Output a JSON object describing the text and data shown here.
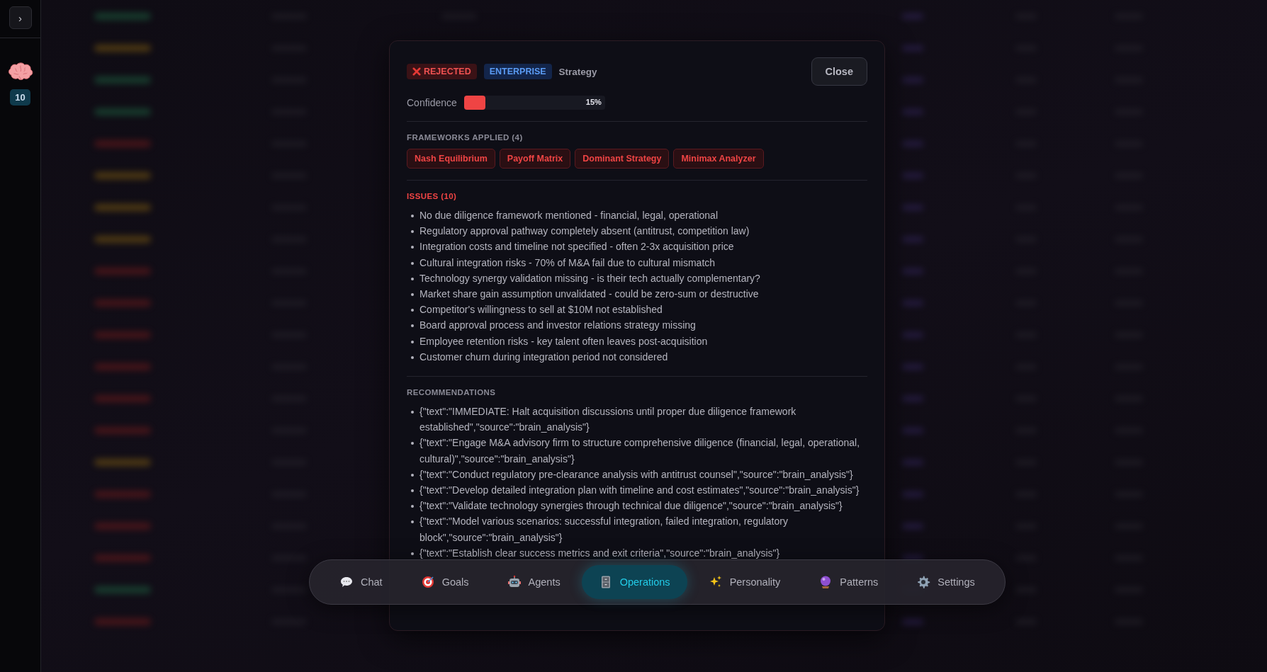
{
  "sidebar": {
    "toggle": "›",
    "count": "10"
  },
  "modal": {
    "status": {
      "label": "REJECTED",
      "kind": "rejected"
    },
    "tier": "ENTERPRISE",
    "category": "Strategy",
    "close": "Close",
    "confidence": {
      "label": "Confidence",
      "level": 0.15,
      "reading": "15%"
    },
    "frameworks": {
      "heading": "FRAMEWORKS APPLIED (4)",
      "items": [
        "Nash Equilibrium",
        "Payoff Matrix",
        "Dominant Strategy",
        "Minimax Analyzer"
      ]
    },
    "issues": {
      "heading": "ISSUES (10)",
      "items": [
        "No due diligence framework mentioned - financial, legal, operational",
        "Regulatory approval pathway completely absent (antitrust, competition law)",
        "Integration costs and timeline not specified - often 2-3x acquisition price",
        "Cultural integration risks - 70% of M&A fail due to cultural mismatch",
        "Technology synergy validation missing - is their tech actually complementary?",
        "Market share gain assumption unvalidated - could be zero-sum or destructive",
        "Competitor's willingness to sell at $10M not established",
        "Board approval process and investor relations strategy missing",
        "Employee retention risks - key talent often leaves post-acquisition",
        "Customer churn during integration period not considered"
      ]
    },
    "recommendations": {
      "heading": "RECOMMENDATIONS",
      "items": [
        "{\"text\":\"IMMEDIATE: Halt acquisition discussions until proper due diligence framework established\",\"source\":\"brain_analysis\"}",
        "{\"text\":\"Engage M&A advisory firm to structure comprehensive diligence (financial, legal, operational, cultural)\",\"source\":\"brain_analysis\"}",
        "{\"text\":\"Conduct regulatory pre-clearance analysis with antitrust counsel\",\"source\":\"brain_analysis\"}",
        "{\"text\":\"Develop detailed integration plan with timeline and cost estimates\",\"source\":\"brain_analysis\"}",
        "{\"text\":\"Validate technology synergies through technical due diligence\",\"source\":\"brain_analysis\"}",
        "{\"text\":\"Model various scenarios: successful integration, failed integration, regulatory block\",\"source\":\"brain_analysis\"}",
        "{\"text\":\"Establish clear success metrics and exit criteria\",\"source\":\"brain_analysis\"}"
      ]
    }
  },
  "nav": [
    {
      "label": "Chat",
      "kind": "chat",
      "selected": false
    },
    {
      "label": "Goals",
      "kind": "goals",
      "selected": false
    },
    {
      "label": "Agents",
      "kind": "agents",
      "selected": false
    },
    {
      "label": "Operations",
      "kind": "operations",
      "selected": true
    },
    {
      "label": "Personality",
      "kind": "personality",
      "selected": false
    },
    {
      "label": "Patterns",
      "kind": "patterns",
      "selected": false
    },
    {
      "label": "Settings",
      "kind": "settings",
      "selected": false
    }
  ]
}
